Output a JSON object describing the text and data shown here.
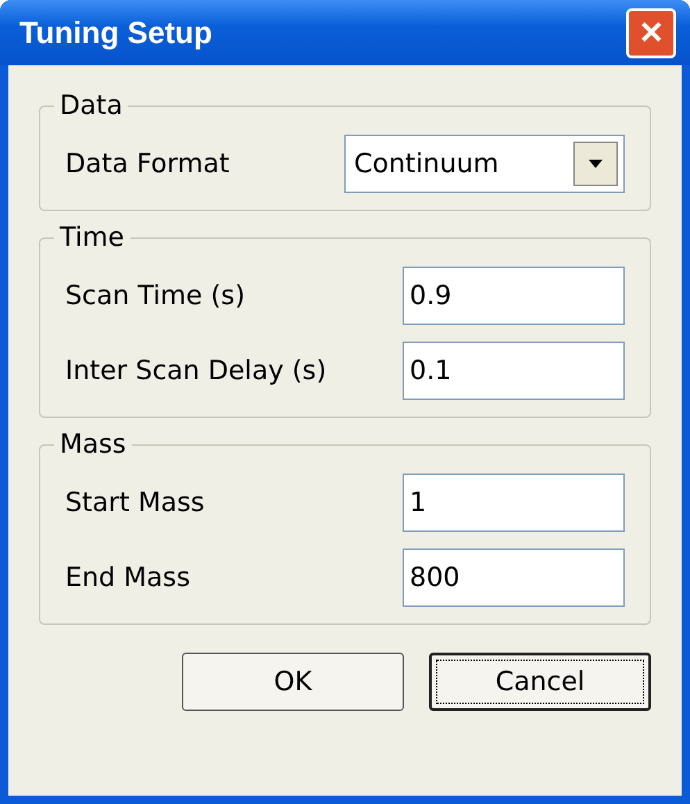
{
  "window": {
    "title": "Tuning Setup",
    "close": "✕"
  },
  "groups": [
    {
      "title": "Data",
      "rows": [
        {
          "kind": "dropdown",
          "label": "Data Format",
          "value": "Continuum"
        }
      ]
    },
    {
      "title": "Time",
      "rows": [
        {
          "kind": "field",
          "label": "Scan Time (s)",
          "value": "0.9"
        },
        {
          "kind": "field",
          "label": "Inter Scan Delay (s)",
          "value": "0.1"
        }
      ]
    },
    {
      "title": "Mass",
      "rows": [
        {
          "kind": "field",
          "label": "Start Mass",
          "value": "1"
        },
        {
          "kind": "field",
          "label": "End Mass",
          "value": "800"
        }
      ]
    }
  ],
  "buttons": [
    {
      "label": "OK",
      "focused": false
    },
    {
      "label": "Cancel",
      "focused": true
    }
  ]
}
